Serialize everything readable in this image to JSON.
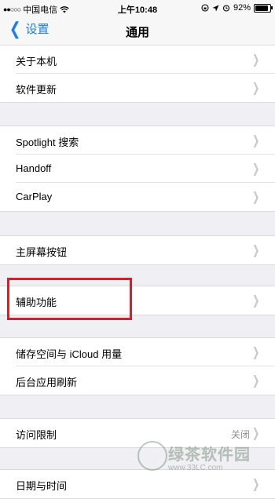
{
  "status_bar": {
    "carrier": "中国电信",
    "signal": "●●○○○",
    "time": "上午10:48",
    "battery_percent": "92%"
  },
  "nav": {
    "back_label": "设置",
    "title": "通用"
  },
  "groups": [
    {
      "rows": [
        {
          "label": "关于本机"
        },
        {
          "label": "软件更新"
        }
      ]
    },
    {
      "rows": [
        {
          "label": "Spotlight 搜索"
        },
        {
          "label": "Handoff"
        },
        {
          "label": "CarPlay"
        }
      ]
    },
    {
      "rows": [
        {
          "label": "主屏幕按钮"
        }
      ]
    },
    {
      "rows": [
        {
          "label": "辅助功能"
        }
      ]
    },
    {
      "rows": [
        {
          "label": "储存空间与 iCloud 用量"
        },
        {
          "label": "后台应用刷新"
        }
      ]
    },
    {
      "rows": [
        {
          "label": "访问限制",
          "value": "关闭"
        }
      ]
    },
    {
      "rows": [
        {
          "label": "日期与时间"
        }
      ]
    }
  ],
  "watermark": {
    "text": "绿茶软件园",
    "url": "www.33LC.com"
  },
  "colors": {
    "accent": "#1a7cf5",
    "highlight": "#d4202a",
    "background": "#efeff4"
  }
}
